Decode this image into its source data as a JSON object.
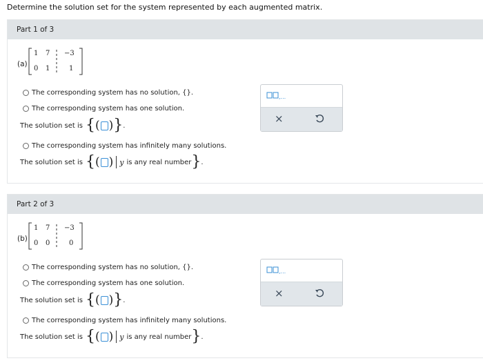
{
  "instruction": "Determine the solution set for the system represented by each augmented matrix.",
  "parts": [
    {
      "header": "Part 1 of 3",
      "label": "(a)",
      "matrix": [
        [
          "1",
          "7",
          "−3"
        ],
        [
          "0",
          "1",
          "1"
        ]
      ],
      "options": {
        "no_solution": "The corresponding system has no solution, {}.",
        "one_solution": "The corresponding system has one solution.",
        "infinite": "The corresponding system has infinitely many solutions."
      },
      "solution_prefix": "The solution set is",
      "var_name": "y",
      "any_real": "is any real number"
    },
    {
      "header": "Part 2 of 3",
      "label": "(b)",
      "matrix": [
        [
          "1",
          "7",
          "−3"
        ],
        [
          "0",
          "0",
          "0"
        ]
      ],
      "options": {
        "no_solution": "The corresponding system has no solution, {}.",
        "one_solution": "The corresponding system has one solution.",
        "infinite": "The corresponding system has infinitely many solutions."
      },
      "solution_prefix": "The solution set is",
      "var_name": "y",
      "any_real": "is any real number"
    }
  ],
  "tool": {
    "clear_symbol": "×",
    "template_icon": "ordered-pair-template-icon",
    "undo_icon": "undo-icon"
  },
  "colors": {
    "header_bg": "#dfe3e6",
    "input_border": "#3a8fd6",
    "toolbar_bg": "#e1e6ea"
  }
}
